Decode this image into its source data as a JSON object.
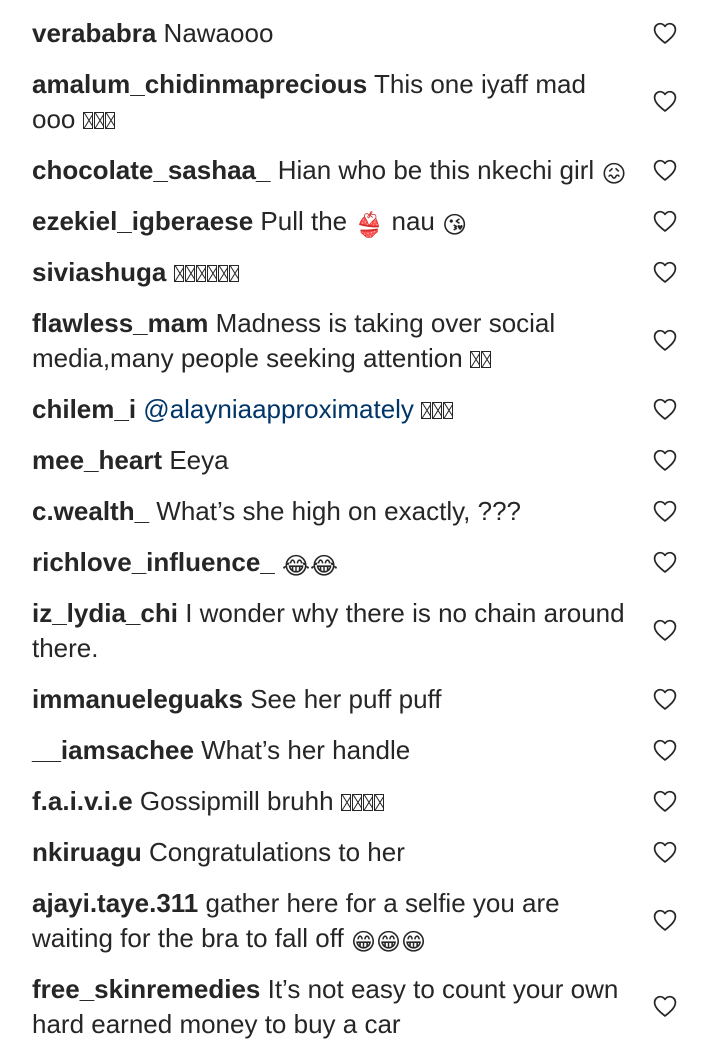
{
  "top_partial_text": "",
  "comments": [
    {
      "username": "verababra",
      "text": "Nawaooo",
      "lines": 1
    },
    {
      "username": "amalum_chidinmaprecious",
      "text": "This one iyaff mad ooo",
      "tofu": 3,
      "lines": 2
    },
    {
      "username": "chocolate_sashaa_",
      "text": "Hian who be this nkechi girl",
      "emoji": "😖",
      "lines": 2
    },
    {
      "username": "ezekiel_igberaese",
      "text": "Pull the",
      "emoji": "👙",
      "text2": "nau",
      "emoji2": "😘",
      "lines": 1
    },
    {
      "username": "siviashuga",
      "text": "",
      "tofu": 6,
      "lines": 1
    },
    {
      "username": "flawless_mam",
      "text": "Madness is taking over social media,many people seeking attention",
      "tofu": 2,
      "lines": 2
    },
    {
      "username": "chilem_i",
      "mention": "@alayniaapproximately",
      "tofu": 3,
      "lines": 1
    },
    {
      "username": "mee_heart",
      "text": "Eeya",
      "lines": 1
    },
    {
      "username": "c.wealth_",
      "text": "What’s she high on exactly, ???",
      "lines": 1
    },
    {
      "username": "richlove_influence_",
      "text": "",
      "emoji": "😂😂",
      "lines": 1
    },
    {
      "username": "iz_lydia_chi",
      "text": "I wonder why there is no chain around there.",
      "lines": 2
    },
    {
      "username": "immanueleguaks",
      "text": "See her puff puff",
      "lines": 1
    },
    {
      "username": "__iamsachee",
      "text": "What’s her handle",
      "lines": 1
    },
    {
      "username": "f.a.i.v.i.e",
      "text": "Gossipmill bruhh",
      "tofu": 4,
      "lines": 1
    },
    {
      "username": "nkiruagu",
      "text": "Congratulations to her",
      "lines": 1
    },
    {
      "username": "ajayi.taye.311",
      "text": "gather here for a selfie you are waiting for the bra to fall off",
      "emoji": "😁😁😁",
      "lines": 2
    },
    {
      "username": "free_skinremedies",
      "text": "It’s not easy to count your own hard earned money to buy a car",
      "lines": 2
    }
  ],
  "icons": {
    "like": "heart-outline-icon"
  },
  "colors": {
    "text": "#262626",
    "mention": "#003569",
    "icon": "#262626",
    "background": "#ffffff"
  }
}
